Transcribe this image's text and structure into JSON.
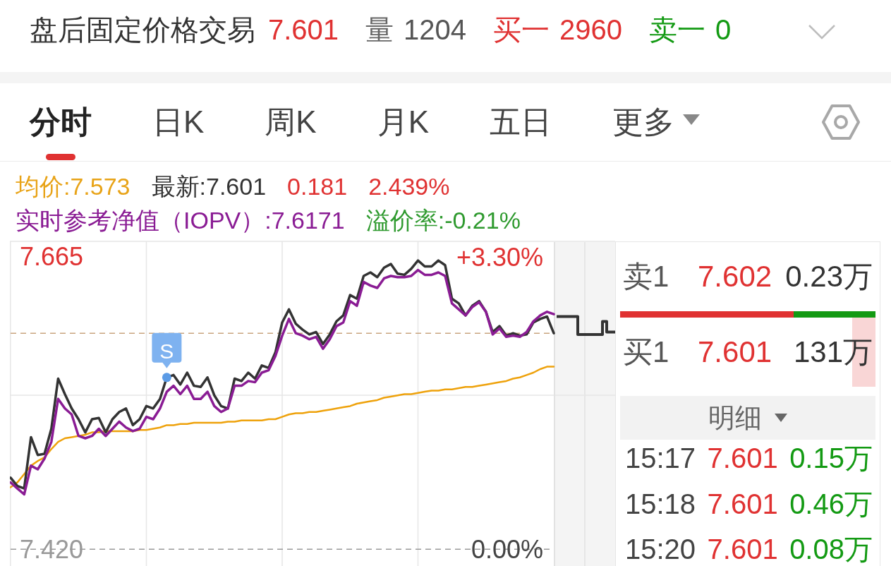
{
  "header": {
    "title": "盘后固定价格交易",
    "price": "7.601",
    "fields": [
      {
        "label": "量",
        "value": "1204",
        "kind": "volume"
      },
      {
        "label": "买一",
        "value": "2960",
        "kind": "bid"
      },
      {
        "label": "卖一",
        "value": "0",
        "kind": "ask"
      }
    ]
  },
  "tabs": [
    {
      "label": "分时",
      "selected": true,
      "kind": "tab"
    },
    {
      "label": "日K",
      "selected": false,
      "kind": "tab"
    },
    {
      "label": "周K",
      "selected": false,
      "kind": "tab"
    },
    {
      "label": "月K",
      "selected": false,
      "kind": "tab"
    },
    {
      "label": "五日",
      "selected": false,
      "kind": "tab"
    },
    {
      "label": "更多",
      "selected": false,
      "kind": "dropdown"
    }
  ],
  "quote": {
    "lines": [
      [
        {
          "text": "均价:7.573",
          "color": "#e8a317"
        },
        {
          "text": "最新:7.601",
          "color": "#333333"
        },
        {
          "text": "0.181",
          "color": "#e03232"
        },
        {
          "text": "2.439%",
          "color": "#e03232"
        }
      ],
      [
        {
          "text": "实时参考净值（IOPV）:7.6171",
          "color": "#8a1c94"
        },
        {
          "text": "溢价率:-0.21%",
          "color": "#2f9a2f"
        }
      ]
    ]
  },
  "chart": {
    "chart_data": {
      "type": "line",
      "grid": true,
      "ylim": [
        7.406,
        7.678
      ],
      "yticks": [
        {
          "value": 7.665,
          "label": "7.665"
        },
        {
          "value": 7.42,
          "label": "7.420"
        }
      ],
      "y2lim": [
        -0.19,
        3.48
      ],
      "y2ticks": [
        {
          "value": 3.3,
          "label": "+3.30%"
        },
        {
          "value": 0,
          "label": "0.00%"
        }
      ],
      "series": [
        {
          "color": "#eea20c",
          "values": [
            7.472,
            7.476,
            7.483,
            7.49,
            7.494,
            7.497,
            7.504,
            7.51,
            7.513,
            7.514,
            7.515,
            7.516,
            7.518,
            7.518,
            7.519,
            7.519,
            7.519,
            7.519,
            7.519,
            7.52,
            7.52,
            7.521,
            7.522,
            7.524,
            7.524,
            7.525,
            7.525,
            7.526,
            7.526,
            7.526,
            7.526,
            7.526,
            7.527,
            7.527,
            7.528,
            7.528,
            7.528,
            7.528,
            7.529,
            7.529,
            7.531,
            7.533,
            7.534,
            7.534,
            7.535,
            7.535,
            7.536,
            7.537,
            7.538,
            7.539,
            7.54,
            7.542,
            7.543,
            7.544,
            7.545,
            7.547,
            7.548,
            7.549,
            7.55,
            7.55,
            7.551,
            7.552,
            7.553,
            7.553,
            7.554,
            7.554,
            7.555,
            7.556,
            7.556,
            7.557,
            7.558,
            7.559,
            7.56,
            7.561,
            7.563,
            7.564,
            7.566,
            7.568,
            7.571,
            7.573,
            7.573
          ]
        },
        {
          "color": "#333333",
          "values": [
            7.48,
            7.473,
            7.471,
            7.514,
            7.499,
            7.5,
            7.521,
            7.563,
            7.55,
            7.538,
            7.529,
            7.518,
            7.529,
            7.53,
            7.518,
            7.529,
            7.535,
            7.538,
            7.524,
            7.529,
            7.54,
            7.538,
            7.546,
            7.564,
            7.566,
            7.558,
            7.568,
            7.557,
            7.556,
            7.564,
            7.549,
            7.54,
            7.538,
            7.563,
            7.561,
            7.568,
            7.563,
            7.574,
            7.572,
            7.585,
            7.61,
            7.621,
            7.609,
            7.604,
            7.6,
            7.602,
            7.592,
            7.6,
            7.611,
            7.616,
            7.633,
            7.63,
            7.649,
            7.652,
            7.648,
            7.656,
            7.659,
            7.651,
            7.65,
            7.655,
            7.662,
            7.657,
            7.657,
            7.662,
            7.658,
            7.63,
            7.626,
            7.616,
            7.624,
            7.628,
            7.619,
            7.602,
            7.607,
            7.599,
            7.601,
            7.599,
            7.6,
            7.61,
            7.613,
            7.615,
            7.601
          ]
        },
        {
          "color": "#8a1c94",
          "values": [
            7.476,
            7.471,
            7.466,
            7.49,
            7.487,
            7.496,
            7.51,
            7.546,
            7.538,
            7.533,
            7.515,
            7.513,
            7.515,
            7.521,
            7.515,
            7.521,
            7.527,
            7.522,
            7.519,
            7.521,
            7.531,
            7.529,
            7.538,
            7.552,
            7.557,
            7.55,
            7.557,
            7.546,
            7.546,
            7.552,
            7.54,
            7.535,
            7.538,
            7.557,
            7.557,
            7.561,
            7.56,
            7.568,
            7.57,
            7.582,
            7.599,
            7.613,
            7.601,
            7.599,
            7.596,
            7.598,
            7.588,
            7.596,
            7.607,
            7.61,
            7.628,
            7.624,
            7.644,
            7.641,
            7.639,
            7.647,
            7.649,
            7.648,
            7.648,
            7.649,
            7.654,
            7.65,
            7.65,
            7.652,
            7.649,
            7.626,
            7.621,
            7.616,
            7.623,
            7.627,
            7.619,
            7.6,
            7.605,
            7.598,
            7.599,
            7.598,
            7.602,
            7.611,
            7.616,
            7.619,
            7.617
          ]
        }
      ],
      "ref_lines": [
        {
          "axis": "y",
          "value": 7.601,
          "color": "#c9a47e"
        },
        {
          "axis": "y",
          "value": 7.42,
          "color": "#9a9a9a"
        }
      ]
    },
    "marker": {
      "label": "S"
    }
  },
  "order_book": {
    "levels": [
      {
        "label": "卖1",
        "price": "7.602",
        "volume": "0.23万"
      },
      {
        "label": "买1",
        "price": "7.601",
        "volume": "131万",
        "level": 0.09
      }
    ],
    "ratio": {
      "level": 0.68
    },
    "detail": {
      "label": "明细"
    },
    "trades": [
      {
        "time": "15:17",
        "price": "7.601",
        "volume": "0.15万",
        "kind": "sell"
      },
      {
        "time": "15:18",
        "price": "7.601",
        "volume": "0.46万",
        "kind": "sell"
      },
      {
        "time": "15:20",
        "price": "7.601",
        "volume": "0.08万",
        "kind": "sell"
      }
    ]
  }
}
